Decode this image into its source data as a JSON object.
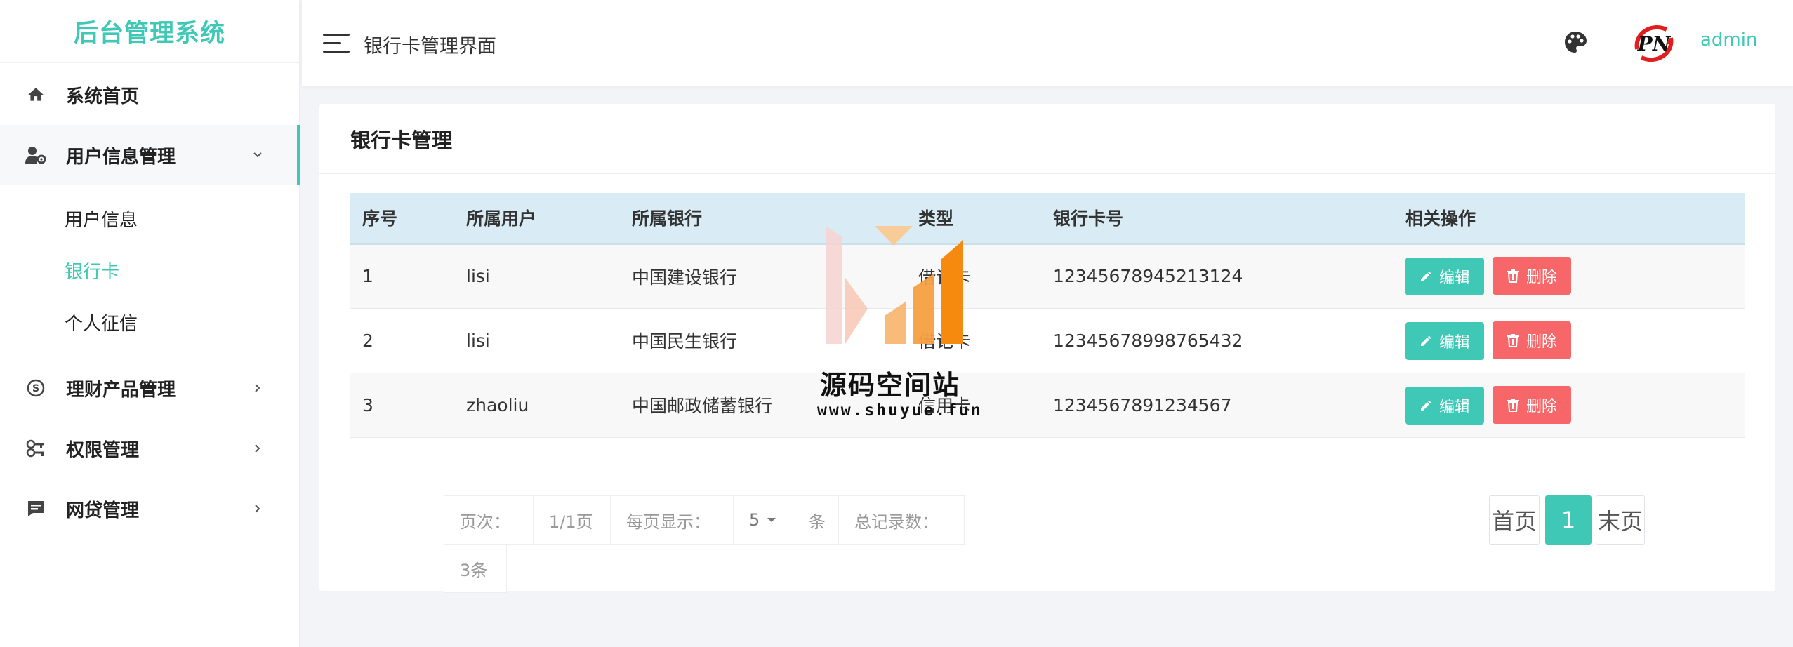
{
  "app": {
    "title": "后台管理系统",
    "page_title": "银行卡管理界面",
    "username": "admin"
  },
  "sidebar": {
    "items": [
      {
        "label": "系统首页",
        "icon": "home-icon"
      },
      {
        "label": "用户信息管理",
        "icon": "user-settings-icon",
        "expanded": true
      },
      {
        "label": "理财产品管理",
        "icon": "finance-icon"
      },
      {
        "label": "权限管理",
        "icon": "key-icon"
      },
      {
        "label": "网贷管理",
        "icon": "message-icon"
      }
    ],
    "subitems": [
      {
        "label": "用户信息"
      },
      {
        "label": "银行卡",
        "current": true
      },
      {
        "label": "个人征信"
      }
    ]
  },
  "card": {
    "title": "银行卡管理"
  },
  "table": {
    "columns": [
      "序号",
      "所属用户",
      "所属银行",
      "类型",
      "银行卡号",
      "相关操作"
    ],
    "rows": [
      {
        "index": "1",
        "user": "lisi",
        "bank": "中国建设银行",
        "type": "借记卡",
        "card_no": "12345678945213124"
      },
      {
        "index": "2",
        "user": "lisi",
        "bank": "中国民生银行",
        "type": "借记卡",
        "card_no": "12345678998765432"
      },
      {
        "index": "3",
        "user": "zhaoliu",
        "bank": "中国邮政储蓄银行",
        "type": "信用卡",
        "card_no": "1234567891234567"
      }
    ],
    "edit_label": "编辑",
    "delete_label": "删除"
  },
  "pagination": {
    "page_label": "页次：",
    "page_value": "1/1页",
    "per_page_label": "每页显示：",
    "per_page_value": "5",
    "unit": "条",
    "total_label": "总记录数：",
    "total_value": "3条",
    "first": "首页",
    "current": "1",
    "last": "末页"
  },
  "watermark": {
    "name": "源码空间站",
    "url": "www.shuyue.fun"
  },
  "colors": {
    "accent": "#3fc8b6",
    "danger": "#f7676a",
    "table_header": "#d9ecf5",
    "background": "#f3f4f7"
  }
}
